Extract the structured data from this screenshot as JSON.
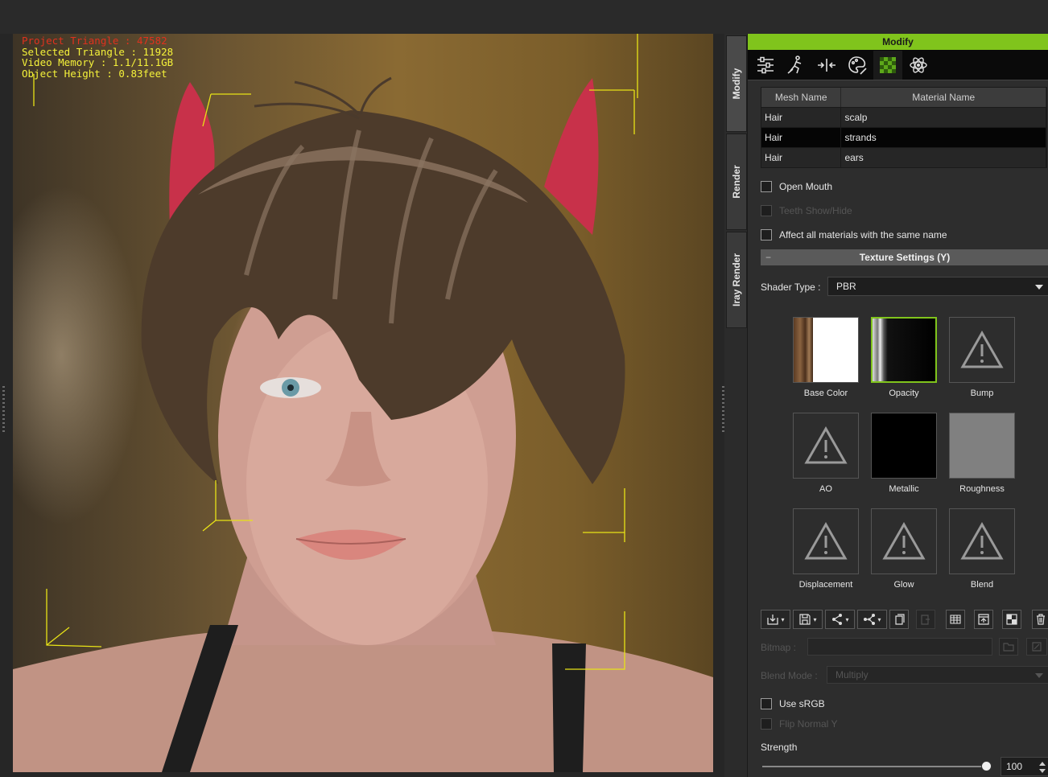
{
  "viewport": {
    "stats": {
      "project_triangle": "Project Triangle : 47582",
      "selected_triangle": "Selected Triangle : 11928",
      "video_memory": "Video Memory : 1.1/11.1GB",
      "object_height": "Object Height : 0.83feet"
    }
  },
  "side_tabs": [
    "Modify",
    "Render",
    "Iray Render"
  ],
  "panel": {
    "header": "Modify",
    "toolbar_icons": [
      "sliders-icon",
      "motion-icon",
      "morph-icon",
      "appearance-icon",
      "material-checker-icon",
      "physics-atom-icon"
    ],
    "table": {
      "headers": [
        "Mesh Name",
        "Material Name"
      ],
      "rows": [
        {
          "mesh": "Hair",
          "material": "scalp"
        },
        {
          "mesh": "Hair",
          "material": "strands"
        },
        {
          "mesh": "Hair",
          "material": "ears"
        }
      ],
      "selected_row": "strands"
    },
    "open_mouth": "Open Mouth",
    "teeth_show_hide": "Teeth Show/Hide",
    "affect_all": "Affect all materials with the same name",
    "texture_section": "Texture Settings  (Y)",
    "shader_type_label": "Shader Type :",
    "shader_type_value": "PBR",
    "textures": [
      {
        "label": "Base Color",
        "state": "image"
      },
      {
        "label": "Opacity",
        "state": "image",
        "selected": true
      },
      {
        "label": "Bump",
        "state": "empty"
      },
      {
        "label": "AO",
        "state": "empty"
      },
      {
        "label": "Metallic",
        "state": "black"
      },
      {
        "label": "Roughness",
        "state": "gray"
      },
      {
        "label": "Displacement",
        "state": "empty"
      },
      {
        "label": "Glow",
        "state": "empty"
      },
      {
        "label": "Blend",
        "state": "empty"
      }
    ],
    "bitmap_label": "Bitmap :",
    "blend_mode_label": "Blend Mode :",
    "blend_mode_value": "Multiply",
    "use_srgb": "Use sRGB",
    "flip_normal_y": "Flip Normal Y",
    "strength_label": "Strength",
    "strength_value": "100",
    "colors": {
      "accent": "#80c41c",
      "stats_text": "#f5f23a",
      "stats_alert": "#e0311e"
    }
  }
}
